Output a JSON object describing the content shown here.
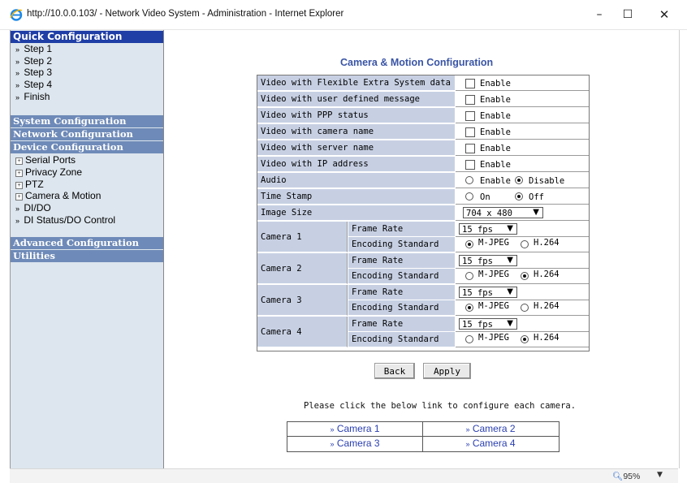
{
  "window": {
    "title": "http://10.0.0.103/ - Network Video System - Administration - Internet Explorer",
    "minimize": "–",
    "maximize": "☐",
    "close": "✕"
  },
  "sidebar": {
    "quick_header": "Quick Configuration",
    "quick_items": [
      "Step 1",
      "Step 2",
      "Step 3",
      "Step 4",
      "Finish"
    ],
    "system_header": "System Configuration",
    "network_header": "Network Configuration",
    "device_header": "Device Configuration",
    "device_items": [
      "Serial Ports",
      "Privacy Zone",
      "PTZ",
      "Camera & Motion",
      "DI/DO",
      "DI Status/DO Control"
    ],
    "advanced_header": "Advanced Configuration",
    "utilities_header": "Utilities"
  },
  "main": {
    "heading": "Camera & Motion Configuration",
    "rows": [
      {
        "label": "Video with Flexible Extra System data",
        "option": "Enable",
        "checked": false
      },
      {
        "label": "Video with user defined message",
        "option": "Enable",
        "checked": false
      },
      {
        "label": "Video with PPP status",
        "option": "Enable",
        "checked": false
      },
      {
        "label": "Video with camera name",
        "option": "Enable",
        "checked": false
      },
      {
        "label": "Video with server name",
        "option": "Enable",
        "checked": false
      },
      {
        "label": "Video with IP address",
        "option": "Enable",
        "checked": false
      }
    ],
    "audio": {
      "label": "Audio",
      "opt1": "Enable",
      "opt2": "Disable",
      "selected": "Disable"
    },
    "timestamp": {
      "label": "Time Stamp",
      "opt1": "On",
      "opt2": "Off",
      "selected": "Off"
    },
    "image_size": {
      "label": "Image Size",
      "value": "704 x 480"
    },
    "cameras": [
      {
        "name": "Camera 1",
        "frame_rate_label": "Frame Rate",
        "frame_rate": "15 fps",
        "encoding_label": "Encoding Standard",
        "opt1": "M-JPEG",
        "opt2": "H.264",
        "selected": "M-JPEG"
      },
      {
        "name": "Camera 2",
        "frame_rate_label": "Frame Rate",
        "frame_rate": "15 fps",
        "encoding_label": "Encoding Standard",
        "opt1": "M-JPEG",
        "opt2": "H.264",
        "selected": "H.264"
      },
      {
        "name": "Camera 3",
        "frame_rate_label": "Frame Rate",
        "frame_rate": "15 fps",
        "encoding_label": "Encoding Standard",
        "opt1": "M-JPEG",
        "opt2": "H.264",
        "selected": "M-JPEG"
      },
      {
        "name": "Camera 4",
        "frame_rate_label": "Frame Rate",
        "frame_rate": "15 fps",
        "encoding_label": "Encoding Standard",
        "opt1": "M-JPEG",
        "opt2": "H.264",
        "selected": "H.264"
      }
    ],
    "back_label": "Back",
    "apply_label": "Apply",
    "note": "Please click the below link to configure each camera.",
    "links": [
      "Camera 1",
      "Camera 2",
      "Camera 3",
      "Camera 4"
    ]
  },
  "status": {
    "zoom": "95%"
  },
  "colors": {
    "sidebar_bg": "#dde6ee",
    "header_first": "#1f3ea6",
    "header": "#6e8ab8",
    "label_bg": "#c7d0e3",
    "heading": "#3a55a6",
    "link": "#2a3fb0"
  },
  "icons": {
    "browser": "internet-explorer-icon",
    "zoom": "zoom-icon",
    "nav_marker": "double-chevron-right-icon",
    "tree_marker": "plus-box-icon"
  }
}
